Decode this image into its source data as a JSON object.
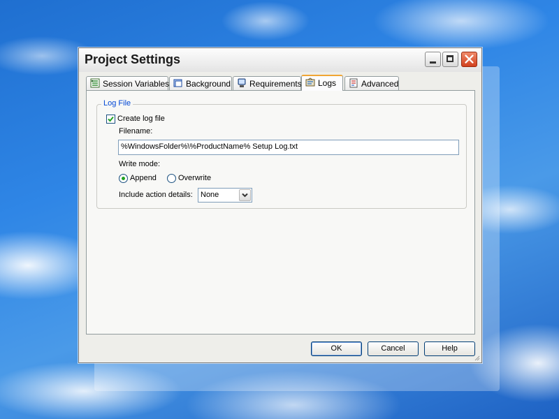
{
  "window": {
    "title": "Project Settings"
  },
  "tabs": [
    {
      "label": "Session Variables",
      "icon": "session-variables-icon",
      "active": false
    },
    {
      "label": "Background",
      "icon": "background-icon",
      "active": false
    },
    {
      "label": "Requirements",
      "icon": "requirements-icon",
      "active": false
    },
    {
      "label": "Logs",
      "icon": "logs-icon",
      "active": true
    },
    {
      "label": "Advanced",
      "icon": "advanced-icon",
      "active": false
    }
  ],
  "log_file": {
    "group_title": "Log File",
    "create_log_label": "Create log file",
    "create_log_checked": true,
    "filename_label": "Filename:",
    "filename_value": "%WindowsFolder%\\%ProductName% Setup Log.txt",
    "write_mode_label": "Write mode:",
    "write_mode_options": [
      "Append",
      "Overwrite"
    ],
    "write_mode_selected": "Append",
    "action_details_label": "Include action details:",
    "action_details_value": "None"
  },
  "buttons": {
    "ok": "OK",
    "cancel": "Cancel",
    "help": "Help"
  },
  "colors": {
    "group_title": "#0046d5",
    "active_tab_accent": "#f0a534",
    "close_button": "#d1401e",
    "check_mark": "#21a121"
  }
}
